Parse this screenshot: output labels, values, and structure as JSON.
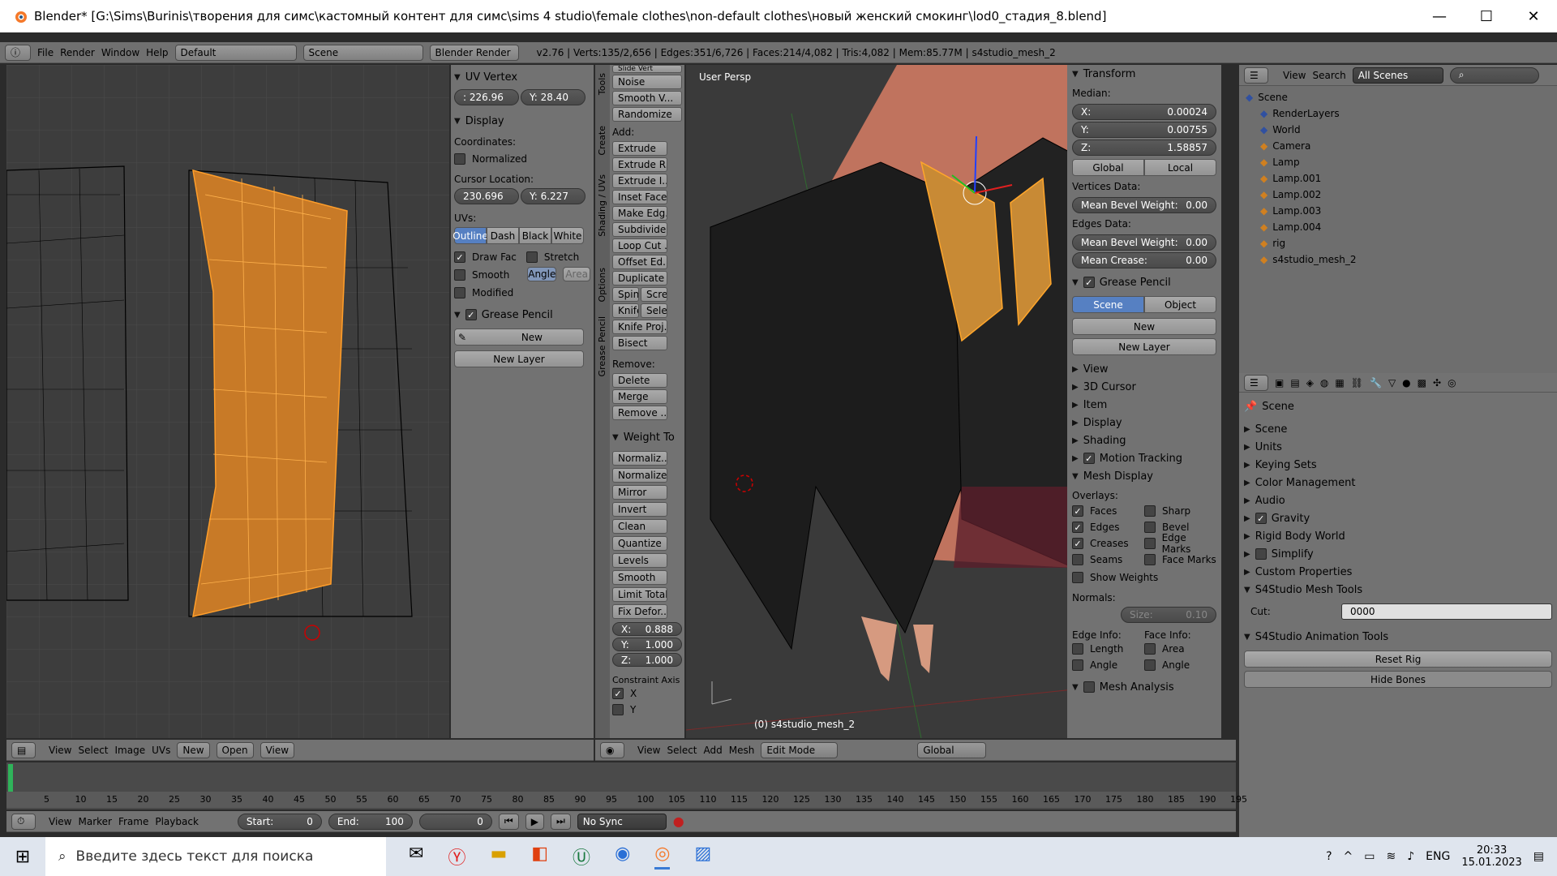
{
  "window": {
    "title": "Blender* [G:\\Sims\\Burinis\\творения для симс\\кастомный контент для симс\\sims 4 studio\\female clothes\\non-default clothes\\новый женский смокинг\\lod0_стадия_8.blend]",
    "minimize": "—",
    "maximize": "☐",
    "close": "✕"
  },
  "menubar": {
    "items": [
      "File",
      "Render",
      "Window",
      "Help"
    ],
    "layout": "Default",
    "scene": "Scene",
    "engine": "Blender Render",
    "stats": "v2.76 | Verts:135/2,656 | Edges:351/6,726 | Faces:214/4,082 | Tris:4,082 | Mem:85.77M | s4studio_mesh_2"
  },
  "uv_panel": {
    "uv_vertex": "UV Vertex",
    "x": ": 226.96",
    "y": "Y: 28.40",
    "display": "Display",
    "coordinates": "Coordinates:",
    "normalized": "Normalized",
    "cursor_location": "Cursor Location:",
    "cx": "230.696",
    "cy": "Y: 6.227",
    "uvs": "UVs:",
    "tabs": [
      "Outline",
      "Dash",
      "Black",
      "White"
    ],
    "draw_fac": "Draw Fac",
    "stretch": "Stretch",
    "smooth": "Smooth",
    "angle": "Angle",
    "area": "Area",
    "modified": "Modified",
    "grease_pencil": "Grease Pencil",
    "new": "New",
    "new_layer": "New Layer"
  },
  "uv_header": {
    "items": [
      "View",
      "Select",
      "Image",
      "UVs"
    ],
    "new": "New",
    "open": "Open",
    "view": "View"
  },
  "tools": {
    "tabs": [
      "Tools",
      "Create",
      "Shading / UVs",
      "Options",
      "Grease Pencil"
    ],
    "top": [
      "Slide Vert",
      "Noise",
      "Smooth V...",
      "Randomize"
    ],
    "add": "Add:",
    "add_items": [
      "Extrude",
      "Extrude R...",
      "Extrude I...",
      "Inset Faces",
      "Make Edg...",
      "Subdivide",
      "Loop Cut ...",
      "Offset Ed...",
      "Duplicate"
    ],
    "spin": "Spin",
    "screw": "Scre",
    "knife": "Knife",
    "sele": "Sele",
    "knife_proj": "Knife Proj...",
    "bisect": "Bisect",
    "remove": "Remove:",
    "delete": "Delete",
    "merge": "Merge",
    "remove_btn": "Remove ...",
    "weight": "Weight To",
    "weight_items": [
      "Normaliz...",
      "Normalize",
      "Mirror",
      "Invert",
      "Clean",
      "Quantize",
      "Levels",
      "Smooth",
      "Limit Total",
      "Fix Defor..."
    ],
    "vx": "X:",
    "vxv": "0.888",
    "vy": "Y:",
    "vyv": "1.000",
    "vz": "Z:",
    "vzv": "1.000",
    "constraint": "Constraint Axis",
    "cx": "X",
    "cy": "Y"
  },
  "viewport": {
    "label": "User Persp",
    "object": "(0) s4studio_mesh_2"
  },
  "view_header": {
    "items": [
      "View",
      "Select",
      "Add",
      "Mesh"
    ],
    "mode": "Edit Mode",
    "orientation": "Global"
  },
  "properties": {
    "transform": "Transform",
    "median": "Median:",
    "x": "X:",
    "xv": "0.00024",
    "y": "Y:",
    "yv": "0.00755",
    "z": "Z:",
    "zv": "1.58857",
    "global": "Global",
    "local": "Local",
    "vertices_data": "Vertices Data:",
    "mean_bevel": "Mean Bevel Weight:",
    "bevel_v": "0.00",
    "edges_data": "Edges Data:",
    "mean_bevel_e": "Mean Bevel Weight:",
    "bevel_e": "0.00",
    "mean_crease": "Mean Crease:",
    "crease_v": "0.00",
    "grease_pencil": "Grease Pencil",
    "scene": "Scene",
    "object": "Object",
    "new": "New",
    "new_layer": "New Layer",
    "collapsed": [
      "View",
      "3D Cursor",
      "Item",
      "Display",
      "Shading"
    ],
    "motion": "Motion Tracking",
    "mesh_display": "Mesh Display",
    "overlays": "Overlays:",
    "faces": "Faces",
    "sharp": "Sharp",
    "edges": "Edges",
    "bevel": "Bevel",
    "creases": "Creases",
    "edge_marks": "Edge Marks",
    "seams": "Seams",
    "face_marks": "Face Marks",
    "show_weights": "Show Weights",
    "normals": "Normals:",
    "size": "Size:",
    "size_v": "0.10",
    "edge_info": "Edge Info:",
    "face_info": "Face Info:",
    "length": "Length",
    "area": "Area",
    "angle": "Angle",
    "angle2": "Angle",
    "mesh_analysis": "Mesh Analysis"
  },
  "outliner": {
    "view": "View",
    "search": "Search",
    "filter": "All Scenes",
    "items": [
      "Scene",
      "RenderLayers",
      "World",
      "Camera",
      "Lamp",
      "Lamp.001",
      "Lamp.002",
      "Lamp.003",
      "Lamp.004",
      "rig",
      "s4studio_mesh_2"
    ]
  },
  "scene_props": {
    "scene": "Scene",
    "sections": [
      "Scene",
      "Units",
      "Keying Sets",
      "Color Management",
      "Audio"
    ],
    "gravity": "Gravity",
    "rigid": "Rigid Body World",
    "simplify": "Simplify",
    "custom": "Custom Properties",
    "mesh_tools": "S4Studio Mesh Tools",
    "cut": "Cut:",
    "cut_v": "0000",
    "anim_tools": "S4Studio Animation Tools",
    "reset_rig": "Reset Rig",
    "hide_bones": "Hide Bones"
  },
  "timeline": {
    "ticks": [
      "5",
      "10",
      "15",
      "20",
      "25",
      "30",
      "35",
      "40",
      "45",
      "50",
      "55",
      "60",
      "65",
      "70",
      "75",
      "80",
      "85",
      "90",
      "95",
      "100",
      "105",
      "110",
      "115",
      "120",
      "125",
      "130",
      "135",
      "140",
      "145",
      "150",
      "155",
      "160",
      "165",
      "170",
      "175",
      "180",
      "185",
      "190",
      "195"
    ],
    "items": [
      "View",
      "Marker",
      "Frame",
      "Playback"
    ],
    "start": "Start:",
    "start_v": "0",
    "end": "End:",
    "end_v": "100",
    "frame": "0",
    "sync": "No Sync"
  },
  "taskbar": {
    "search": "Введите здесь текст для поиска",
    "lang": "ENG",
    "time": "20:33",
    "date": "15.01.2023"
  }
}
